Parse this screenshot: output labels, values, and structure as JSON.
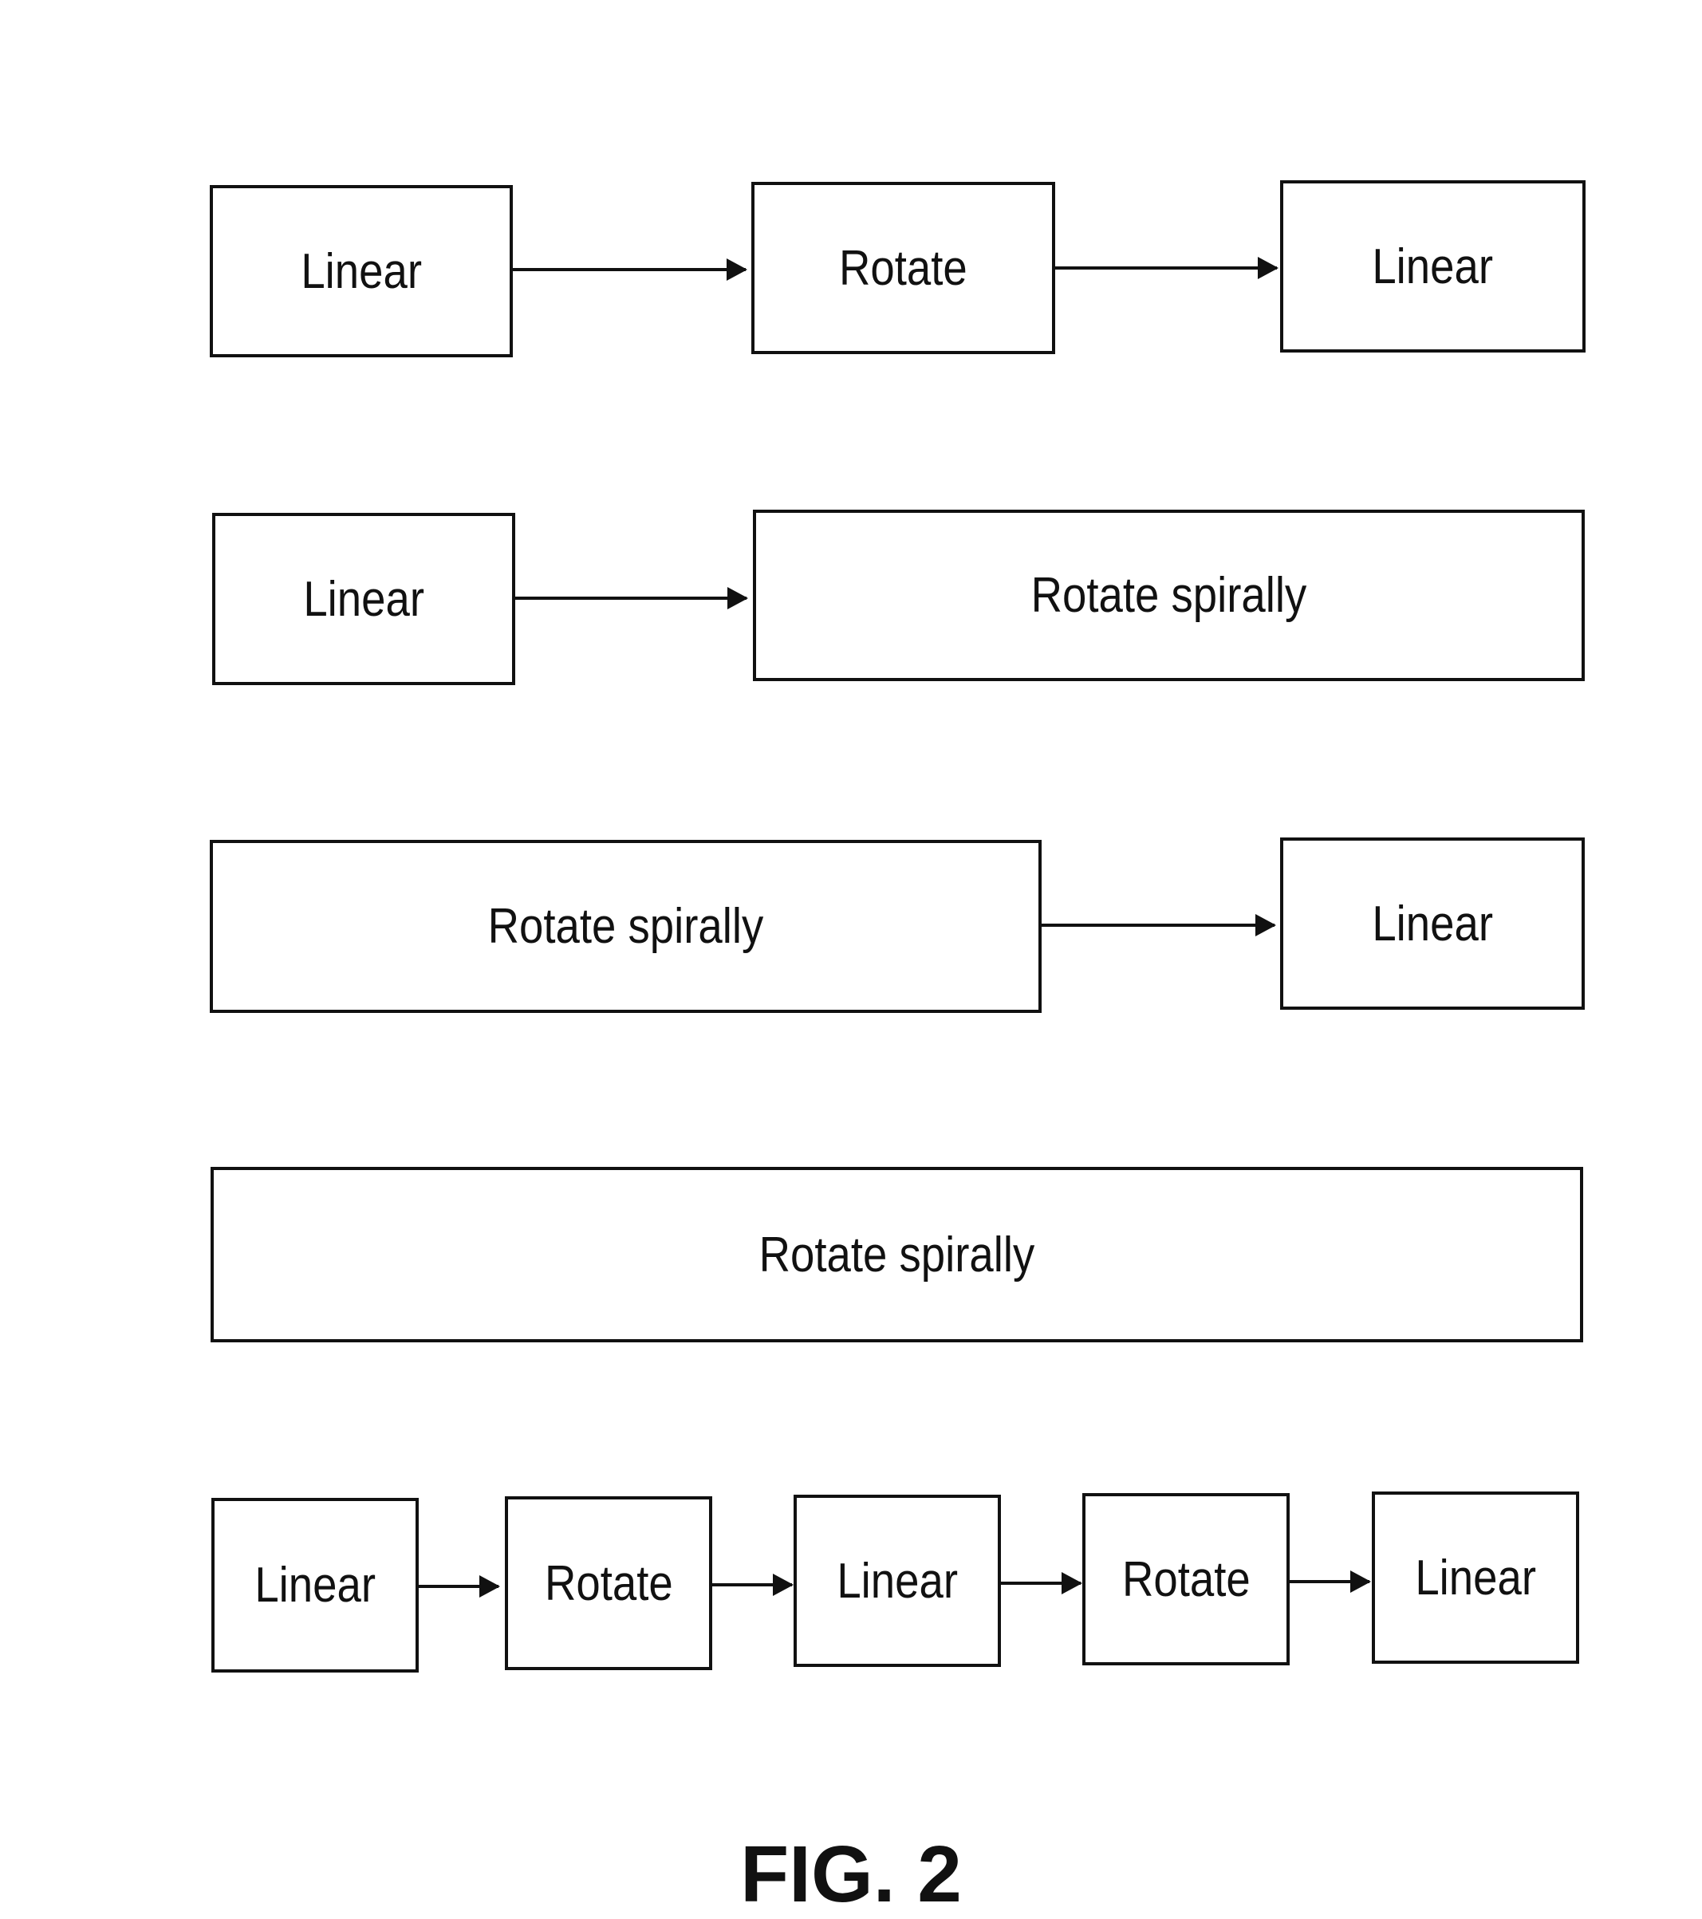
{
  "figure_label": "FIG. 2",
  "rows": [
    {
      "steps": [
        "Linear",
        "Rotate",
        "Linear"
      ]
    },
    {
      "steps": [
        "Linear",
        "Rotate spirally"
      ]
    },
    {
      "steps": [
        "Rotate spirally",
        "Linear"
      ]
    },
    {
      "steps": [
        "Rotate spirally"
      ]
    },
    {
      "steps": [
        "Linear",
        "Rotate",
        "Linear",
        "Rotate",
        "Linear"
      ]
    }
  ]
}
